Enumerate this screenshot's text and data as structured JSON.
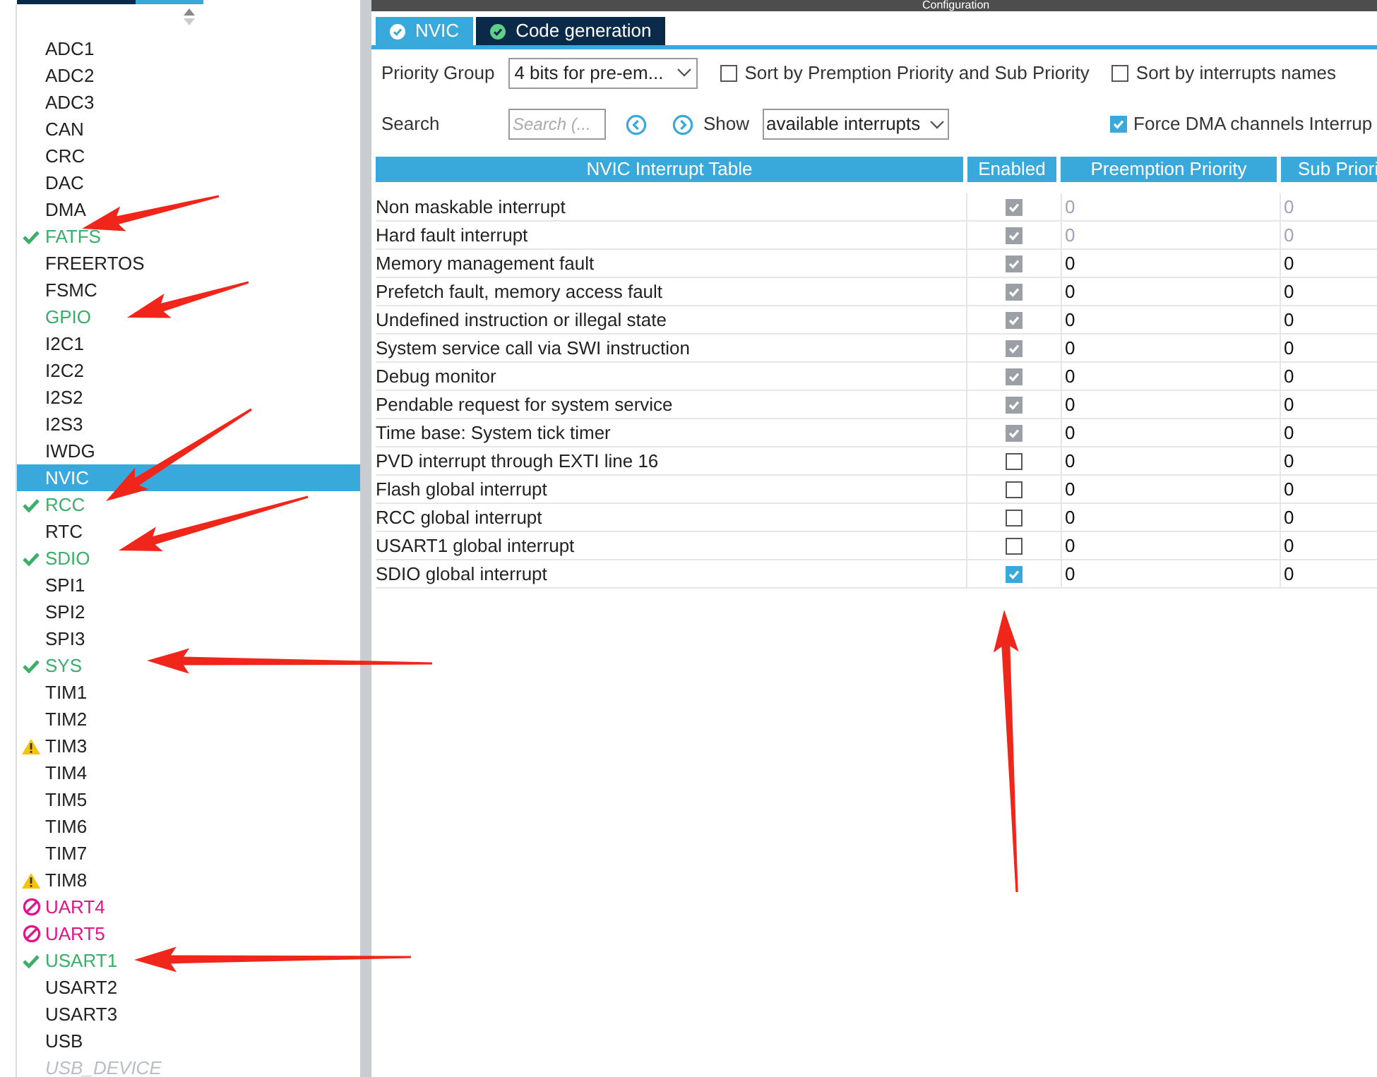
{
  "window": {
    "title": "Configuration"
  },
  "modules": [
    {
      "name": "ADC1",
      "kind": "normal",
      "selected": false
    },
    {
      "name": "ADC2",
      "kind": "normal",
      "selected": false
    },
    {
      "name": "ADC3",
      "kind": "normal",
      "selected": false
    },
    {
      "name": "CAN",
      "kind": "normal",
      "selected": false
    },
    {
      "name": "CRC",
      "kind": "normal",
      "selected": false
    },
    {
      "name": "DAC",
      "kind": "normal",
      "selected": false
    },
    {
      "name": "DMA",
      "kind": "normal",
      "selected": false
    },
    {
      "name": "FATFS",
      "kind": "ok",
      "selected": false
    },
    {
      "name": "FREERTOS",
      "kind": "normal",
      "selected": false
    },
    {
      "name": "FSMC",
      "kind": "normal",
      "selected": false
    },
    {
      "name": "GPIO",
      "kind": "enabled",
      "selected": false
    },
    {
      "name": "I2C1",
      "kind": "normal",
      "selected": false
    },
    {
      "name": "I2C2",
      "kind": "normal",
      "selected": false
    },
    {
      "name": "I2S2",
      "kind": "normal",
      "selected": false
    },
    {
      "name": "I2S3",
      "kind": "normal",
      "selected": false
    },
    {
      "name": "IWDG",
      "kind": "normal",
      "selected": false
    },
    {
      "name": "NVIC",
      "kind": "normal",
      "selected": true
    },
    {
      "name": "RCC",
      "kind": "ok",
      "selected": false
    },
    {
      "name": "RTC",
      "kind": "normal",
      "selected": false
    },
    {
      "name": "SDIO",
      "kind": "ok",
      "selected": false
    },
    {
      "name": "SPI1",
      "kind": "normal",
      "selected": false
    },
    {
      "name": "SPI2",
      "kind": "normal",
      "selected": false
    },
    {
      "name": "SPI3",
      "kind": "normal",
      "selected": false
    },
    {
      "name": "SYS",
      "kind": "ok",
      "selected": false
    },
    {
      "name": "TIM1",
      "kind": "normal",
      "selected": false
    },
    {
      "name": "TIM2",
      "kind": "normal",
      "selected": false
    },
    {
      "name": "TIM3",
      "kind": "warning",
      "selected": false
    },
    {
      "name": "TIM4",
      "kind": "normal",
      "selected": false
    },
    {
      "name": "TIM5",
      "kind": "normal",
      "selected": false
    },
    {
      "name": "TIM6",
      "kind": "normal",
      "selected": false
    },
    {
      "name": "TIM7",
      "kind": "normal",
      "selected": false
    },
    {
      "name": "TIM8",
      "kind": "warning",
      "selected": false
    },
    {
      "name": "UART4",
      "kind": "error",
      "selected": false
    },
    {
      "name": "UART5",
      "kind": "error",
      "selected": false
    },
    {
      "name": "USART1",
      "kind": "ok",
      "selected": false
    },
    {
      "name": "USART2",
      "kind": "normal",
      "selected": false
    },
    {
      "name": "USART3",
      "kind": "normal",
      "selected": false
    },
    {
      "name": "USB",
      "kind": "normal",
      "selected": false
    },
    {
      "name": "USB_DEVICE",
      "kind": "disabled",
      "selected": false
    }
  ],
  "tabs": [
    {
      "label": "NVIC",
      "selected": true
    },
    {
      "label": "Code generation",
      "selected": false
    }
  ],
  "priority_group": {
    "label": "Priority Group",
    "value": "4 bits for pre-em..."
  },
  "sort_options": [
    {
      "label": "Sort by Premption Priority and Sub Priority",
      "checked": false
    },
    {
      "label": "Sort by interrupts names",
      "checked": false
    }
  ],
  "search": {
    "label": "Search",
    "placeholder": "Search (..."
  },
  "show": {
    "label": "Show",
    "value": "available interrupts"
  },
  "force_dma": {
    "label": "Force DMA channels Interrup",
    "checked": true
  },
  "table": {
    "columns": [
      "NVIC Interrupt Table",
      "Enabled",
      "Preemption Priority",
      "Sub Priori"
    ],
    "rows": [
      {
        "name": "Non maskable interrupt",
        "enabled": true,
        "kind": "fixed",
        "preemption": "0",
        "sub": "0",
        "priority_disabled": true
      },
      {
        "name": "Hard fault interrupt",
        "enabled": true,
        "kind": "fixed",
        "preemption": "0",
        "sub": "0",
        "priority_disabled": true
      },
      {
        "name": "Memory management fault",
        "enabled": true,
        "kind": "fixed",
        "preemption": "0",
        "sub": "0",
        "priority_disabled": false
      },
      {
        "name": "Prefetch fault, memory access fault",
        "enabled": true,
        "kind": "fixed",
        "preemption": "0",
        "sub": "0",
        "priority_disabled": false
      },
      {
        "name": "Undefined instruction or illegal state",
        "enabled": true,
        "kind": "fixed",
        "preemption": "0",
        "sub": "0",
        "priority_disabled": false
      },
      {
        "name": "System service call via SWI instruction",
        "enabled": true,
        "kind": "fixed",
        "preemption": "0",
        "sub": "0",
        "priority_disabled": false
      },
      {
        "name": "Debug monitor",
        "enabled": true,
        "kind": "fixed",
        "preemption": "0",
        "sub": "0",
        "priority_disabled": false
      },
      {
        "name": "Pendable request for system service",
        "enabled": true,
        "kind": "fixed",
        "preemption": "0",
        "sub": "0",
        "priority_disabled": false
      },
      {
        "name": "Time base: System tick timer",
        "enabled": true,
        "kind": "fixed",
        "preemption": "0",
        "sub": "0",
        "priority_disabled": false
      },
      {
        "name": "PVD interrupt through EXTI line 16",
        "enabled": false,
        "kind": "editable",
        "preemption": "0",
        "sub": "0",
        "priority_disabled": false
      },
      {
        "name": "Flash global interrupt",
        "enabled": false,
        "kind": "editable",
        "preemption": "0",
        "sub": "0",
        "priority_disabled": false
      },
      {
        "name": "RCC global interrupt",
        "enabled": false,
        "kind": "editable",
        "preemption": "0",
        "sub": "0",
        "priority_disabled": false
      },
      {
        "name": "USART1 global interrupt",
        "enabled": false,
        "kind": "editable",
        "preemption": "0",
        "sub": "0",
        "priority_disabled": false
      },
      {
        "name": "SDIO global interrupt",
        "enabled": true,
        "kind": "editable",
        "preemption": "0",
        "sub": "0",
        "priority_disabled": false
      }
    ]
  }
}
